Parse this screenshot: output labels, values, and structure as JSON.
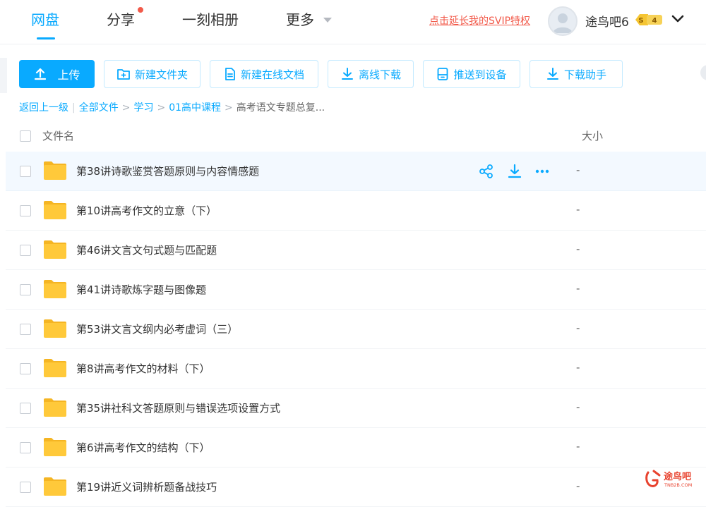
{
  "nav": {
    "items": [
      "网盘",
      "分享",
      "一刻相册",
      "更多"
    ],
    "svip_link": "点击延长我的SVIP特权",
    "username": "途鸟吧6",
    "vip_level": "4",
    "vip_prefix": "S"
  },
  "toolbar": {
    "upload": "上传",
    "new_folder": "新建文件夹",
    "new_doc": "新建在线文档",
    "offline_download": "离线下载",
    "push_device": "推送到设备",
    "download_helper": "下载助手"
  },
  "breadcrumb": {
    "back": "返回上一级",
    "items": [
      "全部文件",
      "学习",
      "01高中课程"
    ],
    "current": "高考语文专题总复..."
  },
  "table": {
    "header_name": "文件名",
    "header_size": "大小",
    "rows": [
      {
        "name": "第38讲诗歌鉴赏答题原则与内容情感题",
        "size": "-"
      },
      {
        "name": "第10讲高考作文的立意（下）",
        "size": "-"
      },
      {
        "name": "第46讲文言文句式题与匹配题",
        "size": "-"
      },
      {
        "name": "第41讲诗歌炼字题与图像题",
        "size": "-"
      },
      {
        "name": "第53讲文言文纲内必考虚词（三）",
        "size": "-"
      },
      {
        "name": "第8讲高考作文的材料（下）",
        "size": "-"
      },
      {
        "name": "第35讲社科文答题原则与错误选项设置方式",
        "size": "-"
      },
      {
        "name": "第6讲高考作文的结构（下）",
        "size": "-"
      },
      {
        "name": "第19讲近义词辨析题备战技巧",
        "size": "-"
      }
    ]
  },
  "watermark": {
    "text": "途鸟吧",
    "sub": "TNB2B.COM"
  },
  "colors": {
    "accent": "#09aaff",
    "link_red": "#f25a4a",
    "folder": "#ffc93a"
  }
}
